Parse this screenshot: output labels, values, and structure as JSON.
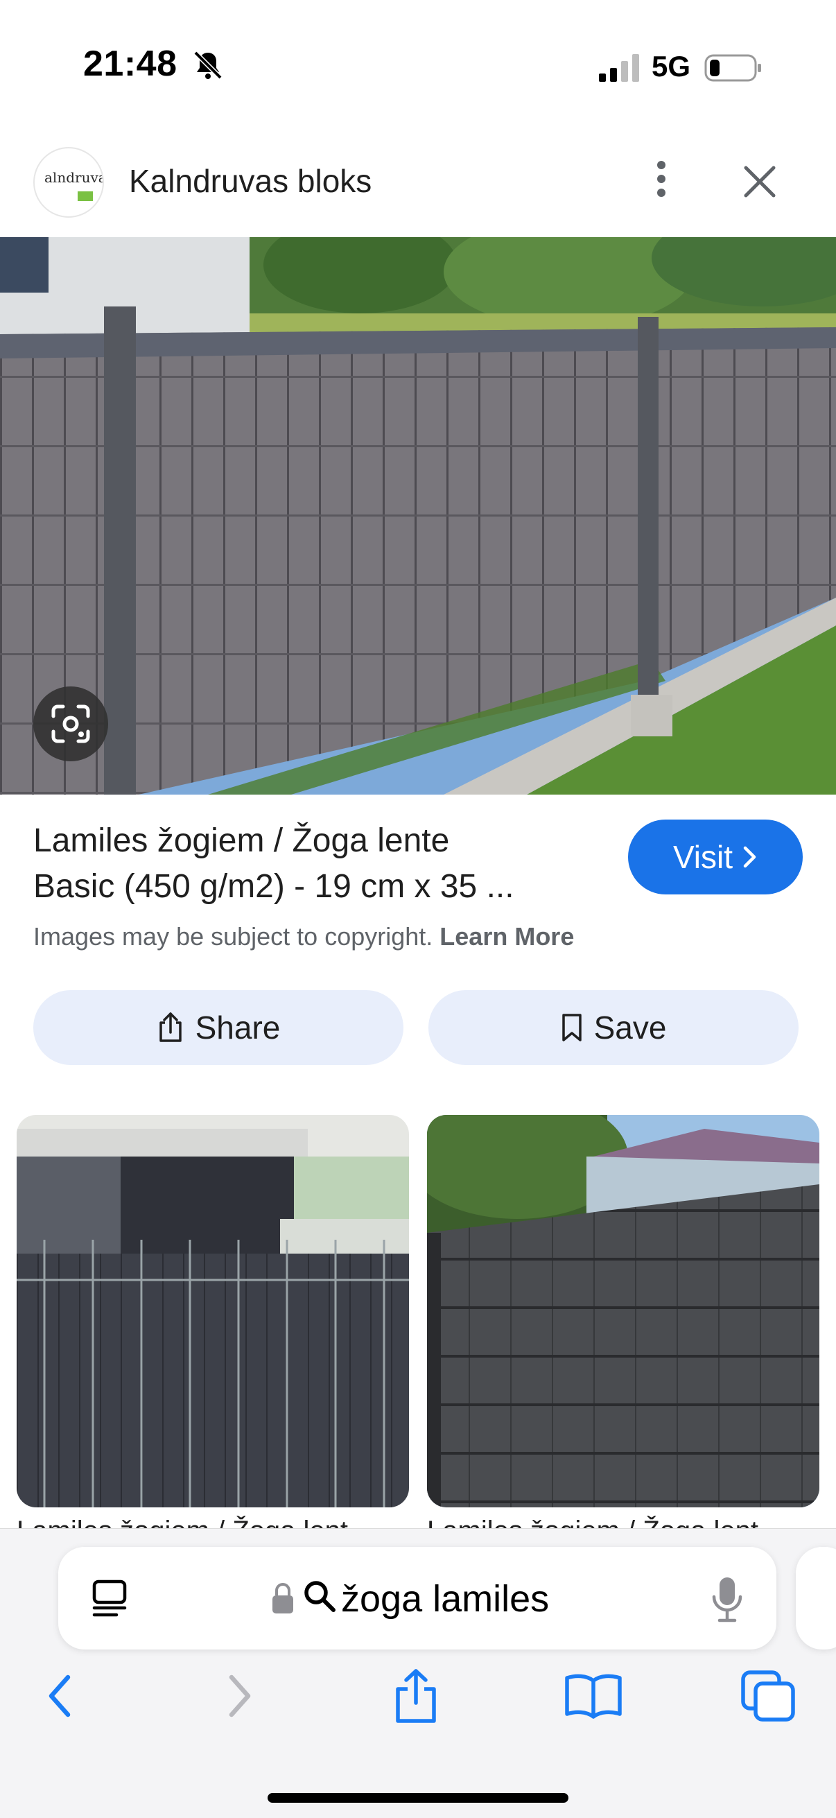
{
  "status_bar": {
    "time": "21:48",
    "network": "5G"
  },
  "header": {
    "site_name": "Kalndruvas bloks",
    "logo_text": "alndruva"
  },
  "result": {
    "title_line1": "Lamiles žogiem / Žoga lente",
    "title_line2": "Basic (450 g/m2) - 19 cm x 35 ...",
    "visit_label": "Visit",
    "copyright_text": "Images may be subject to copyright.",
    "learn_more": "Learn More"
  },
  "actions": {
    "share_label": "Share",
    "save_label": "Save"
  },
  "related": [
    {
      "caption": "Lamiles žogiem / Žoga lent"
    },
    {
      "caption": "Lamiles žogiem / Žoga lent"
    }
  ],
  "browser": {
    "address": "žoga lamiles"
  },
  "colors": {
    "accent": "#1a73e8",
    "pill_bg": "#e8eefb",
    "toolbar_blue": "#1a7cf5"
  }
}
